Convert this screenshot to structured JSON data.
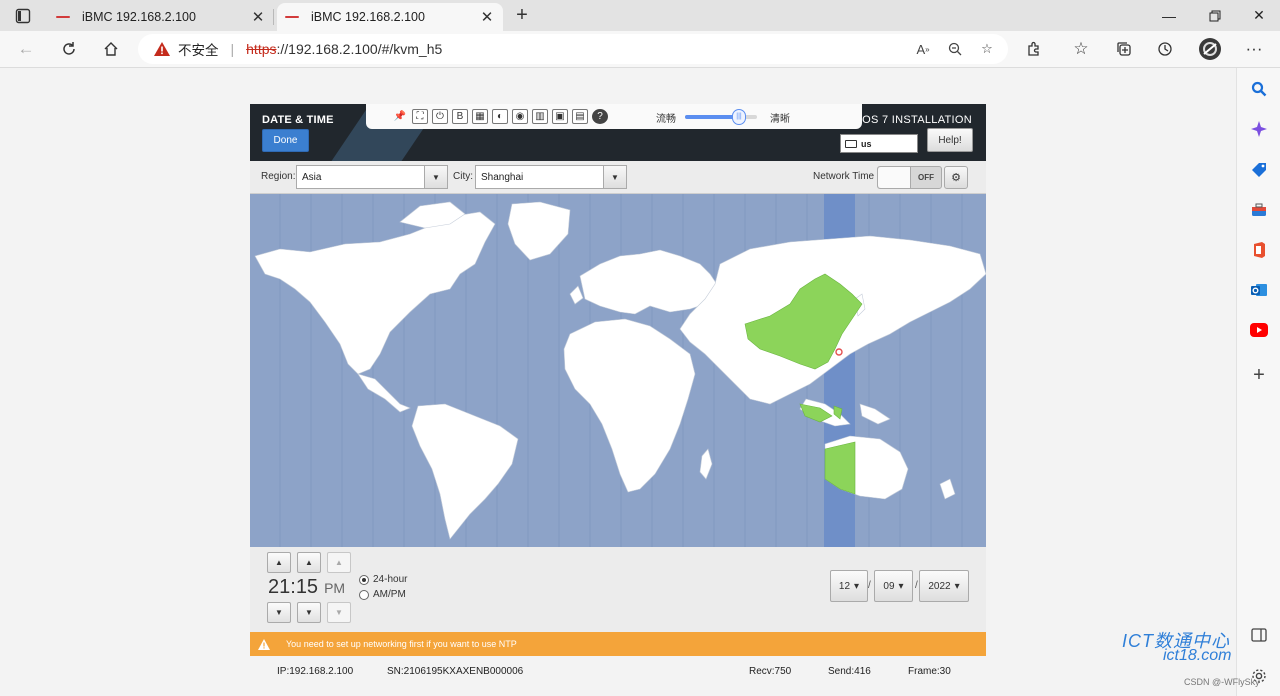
{
  "browser": {
    "tabs": [
      {
        "title": "iBMC 192.168.2.100",
        "active": false
      },
      {
        "title": "iBMC 192.168.2.100",
        "active": true
      }
    ],
    "address": {
      "security_label": "不安全",
      "scheme": "https",
      "rest": "://192.168.2.100/#/kvm_h5"
    }
  },
  "kvm": {
    "screen_title": "DATE & TIME",
    "done_label": "Done",
    "install_title": "NTOS 7 INSTALLATION",
    "keyboard_layout": "us",
    "help_label": "Help!",
    "quality": {
      "low_label": "流畅",
      "high_label": "清晰",
      "level": 0.75
    },
    "region_label": "Region:",
    "region_value": "Asia",
    "city_label": "City:",
    "city_value": "Shanghai",
    "network_time_label": "Network Time",
    "network_time_state": "OFF",
    "time": {
      "hour": "21",
      "minute": "15",
      "ampm": "PM"
    },
    "format_24": "24-hour",
    "format_ampm": "AM/PM",
    "date": {
      "month": "12",
      "day": "09",
      "year": "2022",
      "separator": "/"
    },
    "ntp_warning": "You need to set up networking first if you want to use NTP",
    "status": {
      "ip": "IP:192.168.2.100",
      "sn": "SN:2106195KXAXENB000006",
      "recv": "Recv:750",
      "send": "Send:416",
      "frame": "Frame:30"
    }
  },
  "watermark": {
    "line1": "ICT数通中心",
    "line2": "ict18.com",
    "credit": "CSDN @-WFlySky"
  },
  "colors": {
    "accent": "#3b7fd0",
    "warning": "#f4a43a",
    "map_ocean": "#8da3c8",
    "selected_zone": "#8cd45a"
  }
}
